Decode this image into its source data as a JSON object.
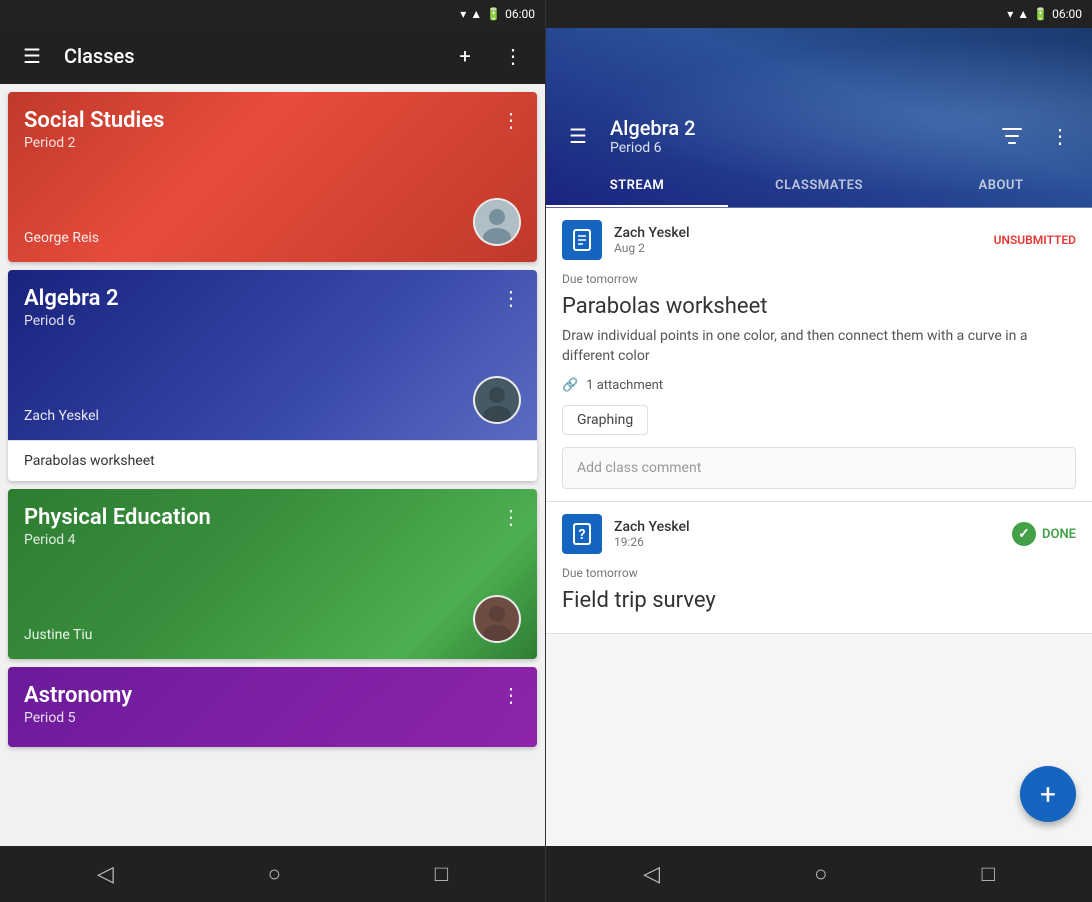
{
  "left_phone": {
    "status_bar": {
      "time": "06:00"
    },
    "toolbar": {
      "title": "Classes",
      "add_label": "+",
      "menu_icon": "⋮"
    },
    "classes": [
      {
        "name": "Social Studies",
        "period": "Period 2",
        "teacher": "George Reis",
        "color": "red",
        "assignment": null
      },
      {
        "name": "Algebra 2",
        "period": "Period 6",
        "teacher": "Zach Yeskel",
        "color": "blue",
        "assignment": "Parabolas worksheet"
      },
      {
        "name": "Physical Education",
        "period": "Period 4",
        "teacher": "Justine Tiu",
        "color": "green",
        "assignment": null
      },
      {
        "name": "Astronomy",
        "period": "Period 5",
        "teacher": "",
        "color": "purple",
        "assignment": null
      }
    ],
    "bottom_nav": {
      "back": "◁",
      "home": "○",
      "recent": "□"
    }
  },
  "right_phone": {
    "status_bar": {
      "time": "06:00"
    },
    "toolbar": {
      "title": "Algebra 2",
      "subtitle": "Period 6",
      "filter_icon": "≡",
      "menu_icon": "⋮"
    },
    "tabs": [
      {
        "label": "STREAM",
        "active": true
      },
      {
        "label": "CLASSMATES",
        "active": false
      },
      {
        "label": "ABOUT",
        "active": false
      }
    ],
    "assignments": [
      {
        "icon": "📋",
        "author": "Zach Yeskel",
        "date": "Aug 2",
        "status": "UNSUBMITTED",
        "due": "Due tomorrow",
        "title": "Parabolas worksheet",
        "description": "Draw individual points in one color, and then connect them with a curve in a different color",
        "attachment_label": "1 attachment",
        "attachment_chip": "Graphing",
        "comment_placeholder": "Add class comment"
      },
      {
        "icon": "❓",
        "author": "Zach Yeskel",
        "date": "19:26",
        "status": "DONE",
        "due": "Due tomorrow",
        "title": "Field trip survey"
      }
    ],
    "fab_icon": "+",
    "bottom_nav": {
      "back": "◁",
      "home": "○",
      "recent": "□"
    }
  }
}
